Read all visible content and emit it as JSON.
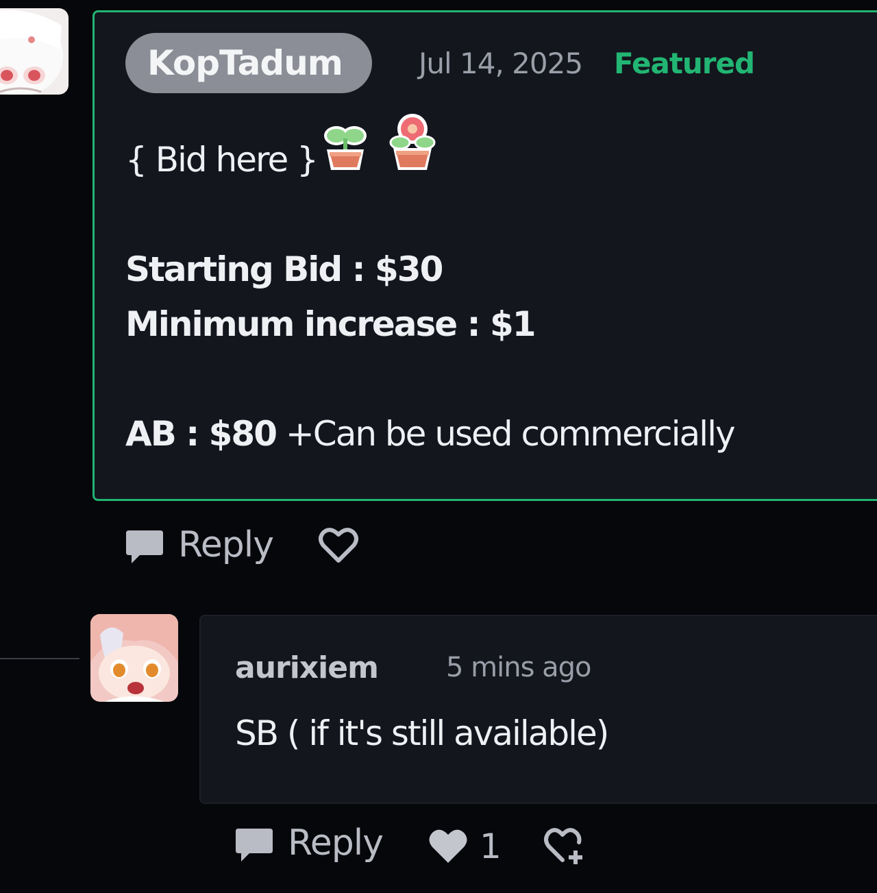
{
  "parent_comment": {
    "username": "KopTadum",
    "timestamp": "Jul 14, 2025",
    "badge": "Featured",
    "avatar_icon": "anime-avatar-white-hair",
    "body": {
      "bid_here": "{ Bid here }",
      "starting_bid": "Starting Bid : $30",
      "minimum_increase": "Minimum increase : $1",
      "ab_price": "AB : $80",
      "ab_note": " +Can be used commercially"
    },
    "emojis": [
      "sprout-pot-icon",
      "flower-pot-icon"
    ],
    "actions": {
      "reply_label": "Reply",
      "like_icon": "heart-outline-icon"
    }
  },
  "reply_comment": {
    "username": "aurixiem",
    "timestamp": "5 mins ago",
    "avatar_icon": "anime-avatar-pink-hair",
    "text": "SB ( if it's still available)",
    "actions": {
      "reply_label": "Reply",
      "like_icon": "heart-filled-icon",
      "like_count": "1",
      "gift_icon": "gift-heart-icon"
    }
  },
  "colors": {
    "background": "#06070b",
    "card": "#13161d",
    "accent_featured": "#22b573",
    "username_pill": "#8b8e96",
    "muted_text": "#9a9ea8",
    "action_gray": "#b9bcc4"
  }
}
